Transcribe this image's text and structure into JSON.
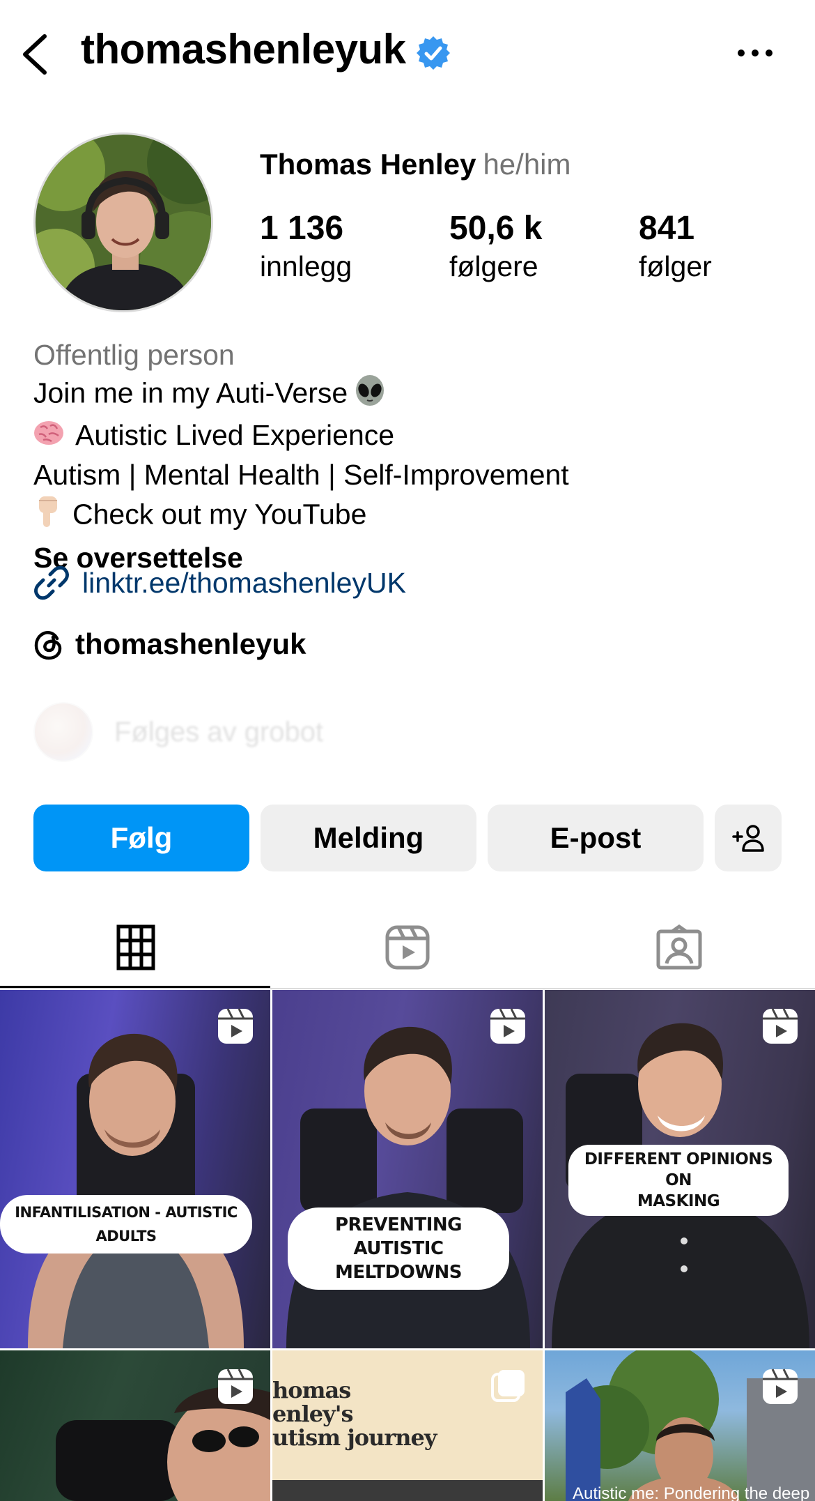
{
  "header": {
    "username": "thomashenleyuk",
    "back_icon": "chevron-left-icon",
    "verified_icon": "verified-badge-icon",
    "more_icon": "more-horizontal-icon"
  },
  "profile": {
    "display_name": "Thomas Henley",
    "pronouns": "he/him",
    "stats": {
      "posts_count": "1 136",
      "posts_label": "innlegg",
      "followers_count": "50,6 k",
      "followers_label": "følgere",
      "following_count": "841",
      "following_label": "følger"
    }
  },
  "bio": {
    "category": "Offentlig person",
    "line1": "Join me in my Auti-Verse",
    "line2": "Autistic Lived Experience",
    "line3": "Autism | Mental Health | Self-Improvement",
    "line4": "Check out my YouTube",
    "see_translation": "Se oversettelse",
    "link": "linktr.ee/thomashenleyUK",
    "threads_handle": "thomashenleyuk",
    "followed_by": "Følges av grobot"
  },
  "actions": {
    "follow": "Følg",
    "message": "Melding",
    "email": "E-post"
  },
  "tabs": [
    "grid-icon",
    "reels-icon",
    "tagged-icon"
  ],
  "posts": [
    {
      "caption": "INFANTILISATION - AUTISTIC ADULTS",
      "type": "reel"
    },
    {
      "caption_l1": "PREVENTING AUTISTIC",
      "caption_l2": "MELTDOWNS",
      "type": "reel"
    },
    {
      "caption_l1": "DIFFERENT OPINIONS ON",
      "caption_l2": "MASKING",
      "type": "reel"
    },
    {
      "caption": "",
      "type": "reel"
    },
    {
      "caption_l1": "homas",
      "caption_l2": "enley's",
      "caption_l3": "utism journey",
      "type": "carousel"
    },
    {
      "caption": "Autistic me: Pondering the deeper",
      "type": "reel"
    }
  ],
  "colors": {
    "accent": "#0095f6",
    "link": "#00376b",
    "muted": "#737373",
    "button_bg": "#efefef"
  }
}
